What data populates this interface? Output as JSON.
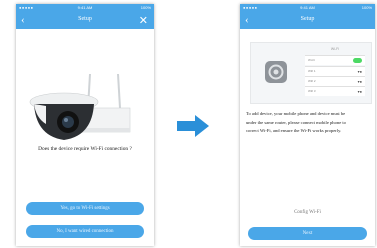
{
  "status": {
    "signal": "●●●●●",
    "time": "9:41 AM",
    "battery": "100%"
  },
  "screen1": {
    "title": "Setup",
    "question": "Does the device require Wi-Fi connection ?",
    "yes_button": "Yes, go to Wi-Fi settings",
    "no_button": "No, I want wired connection"
  },
  "screen2": {
    "title": "Setup",
    "wifi_header": "Wi-Fi",
    "wifi_rows": [
      "Wi-Fi",
      "Wifi 1",
      "Wifi 2",
      "Wifi 3"
    ],
    "instructions": [
      "To add device, your mobile phone and device must be",
      "under the same router, please connect mobile phone to",
      "correct Wi-Fi, and ensure the Wi-Fi works properly."
    ],
    "config_link": "Config Wi-Fi",
    "next_button": "Next"
  },
  "icons": {
    "back": "chevron-left-icon",
    "close": "close-icon",
    "arrow": "arrow-right-icon",
    "settings": "settings-icon"
  },
  "colors": {
    "accent": "#4aa7e8",
    "arrow": "#2a8fd8"
  }
}
